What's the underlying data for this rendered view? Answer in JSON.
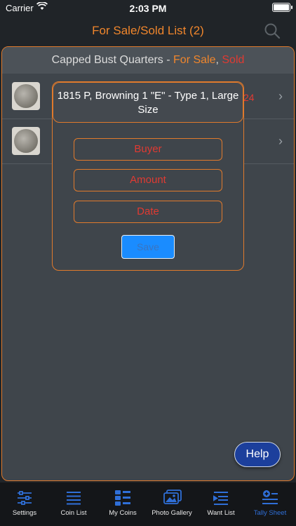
{
  "status_bar": {
    "carrier": "Carrier",
    "time": "2:03 PM"
  },
  "nav": {
    "title": "For Sale/Sold List (2)"
  },
  "list": {
    "header_prefix": "Capped Bust Quarters - ",
    "header_forsale": "For Sale",
    "header_sep": ", ",
    "header_sold": "Sold",
    "rows": [
      {
        "partial_text": "24"
      },
      {
        "partial_text": ""
      }
    ]
  },
  "modal": {
    "title": "1815 P, Browning 1 \"E\" - Type 1, Large Size",
    "buyer_placeholder": "Buyer",
    "amount_placeholder": "Amount",
    "date_placeholder": "Date",
    "save_label": "Save"
  },
  "help_label": "Help",
  "tabs": [
    {
      "label": "Settings",
      "icon": "sliders-icon"
    },
    {
      "label": "Coin List",
      "icon": "list-icon"
    },
    {
      "label": "My Coins",
      "icon": "grid-list-icon"
    },
    {
      "label": "Photo Gallery",
      "icon": "photos-icon"
    },
    {
      "label": "Want List",
      "icon": "want-list-icon"
    },
    {
      "label": "Tally Sheet",
      "icon": "tally-icon",
      "active": true
    }
  ],
  "colors": {
    "accent_orange": "#f0862c",
    "sold_red": "#e03a32",
    "tab_active": "#2f6fd8",
    "save_blue": "#1a8cff"
  }
}
